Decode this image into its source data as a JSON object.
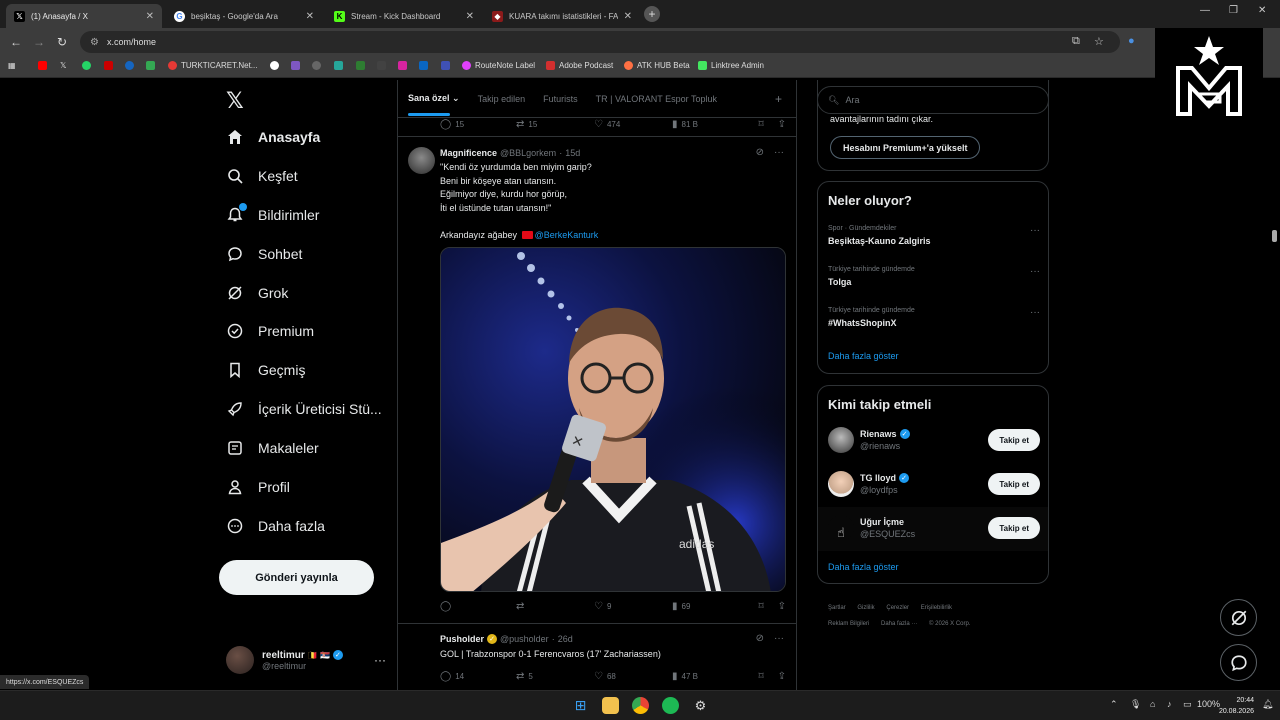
{
  "browser": {
    "tabs": [
      {
        "title": "(1) Anasayfa / X",
        "icon": "x-logo-icon",
        "active": true
      },
      {
        "title": "beşiktaş - Google'da Ara",
        "icon": "google-icon",
        "active": false
      },
      {
        "title": "Stream - Kick Dashboard",
        "icon": "kick-icon",
        "active": false
      },
      {
        "title": "KUARA takımı istatistikleri - FA...",
        "icon": "site-icon",
        "active": false
      }
    ],
    "url": "x.com/home",
    "bookmarks": [
      "TURKTICARET.Net...",
      "RouteNote Label",
      "Adobe Podcast",
      "ATK HUB Beta",
      "Linktree Admin"
    ],
    "status_url": "https://x.com/ESQUEZcs"
  },
  "nav": {
    "items": [
      {
        "label": "Anasayfa",
        "icon": "home-icon"
      },
      {
        "label": "Keşfet",
        "icon": "search-icon"
      },
      {
        "label": "Bildirimler",
        "icon": "bell-icon"
      },
      {
        "label": "Sohbet",
        "icon": "chat-icon"
      },
      {
        "label": "Grok",
        "icon": "grok-icon"
      },
      {
        "label": "Premium",
        "icon": "premium-icon"
      },
      {
        "label": "Geçmiş",
        "icon": "bookmark-icon"
      },
      {
        "label": "İçerik Üreticisi Stü...",
        "icon": "rocket-icon"
      },
      {
        "label": "Makaleler",
        "icon": "article-icon"
      },
      {
        "label": "Profil",
        "icon": "person-icon"
      },
      {
        "label": "Daha fazla",
        "icon": "more-circle-icon"
      }
    ],
    "post_button": "Gönderi yayınla",
    "account": {
      "display_name": "reeltimur",
      "handle": "@reeltimur"
    }
  },
  "feed": {
    "tabs": [
      "Sana özel",
      "Takip edilen",
      "Futurists",
      "TR | VALORANT Espor Topluk"
    ],
    "prev_tweet_stats": {
      "replies": "15",
      "reposts": "15",
      "likes": "474",
      "views": "81 B"
    },
    "tweet1": {
      "display_name": "Magnificence",
      "handle": "@BBLgorkem",
      "time": "15d",
      "lines": [
        "\"Kendi öz yurdumda ben miyim garip?",
        "Beni bir köşeye atan utansın.",
        "Eğilmiyor diye, kurdu hor görüp,",
        "İti el üstünde tutan utansın!\""
      ],
      "closing_text": "Arkandayız ağabey",
      "mention": "@BerkeKanturk",
      "stats": {
        "replies": "",
        "reposts": "",
        "likes": "9",
        "views": "69"
      }
    },
    "tweet2": {
      "display_name": "Pusholder",
      "handle": "@pusholder",
      "time": "26d",
      "text": "GOL | Trabzonspor 0-1 Ferencvaros (17' Zachariassen)",
      "stats": {
        "replies": "14",
        "reposts": "5",
        "likes": "68",
        "views": "47 B"
      }
    }
  },
  "sidebar": {
    "search_placeholder": "Ara",
    "premium_text": "avantajlarının tadını çıkar.",
    "premium_button": "Hesabını Premium+'a yükselt",
    "trends_title": "Neler oluyor?",
    "trends": [
      {
        "context": "Spor · Gündemdekiler",
        "name": "Beşiktaş-Kauno Zalgiris"
      },
      {
        "context": "Türkiye tarihinde gündemde",
        "name": "Tolga"
      },
      {
        "context": "Türkiye tarihinde gündemde",
        "name": "#WhatsShopinX"
      }
    ],
    "show_more": "Daha fazla göster",
    "follow_title": "Kimi takip etmeli",
    "follow_button": "Takip et",
    "follow": [
      {
        "name": "Rienaws",
        "handle": "@rienaws",
        "verified": true
      },
      {
        "name": "TG lloyd",
        "handle": "@loydfps",
        "verified": true
      },
      {
        "name": "Uğur İçme",
        "handle": "@ESQUEZcs",
        "verified": false
      }
    ],
    "footer": [
      "Şartlar",
      "Gizlilik",
      "Çerezler",
      "Erişilebilirlik",
      "Reklam Bilgileri",
      "Daha fazla ···",
      "© 2026 X Corp."
    ]
  },
  "taskbar": {
    "battery": "100%",
    "time": "20:44",
    "date": "20.08.2026"
  },
  "colors": {
    "accent": "#1d9bf0",
    "background": "#000000",
    "border": "#2f3336",
    "muted": "#71767b"
  }
}
